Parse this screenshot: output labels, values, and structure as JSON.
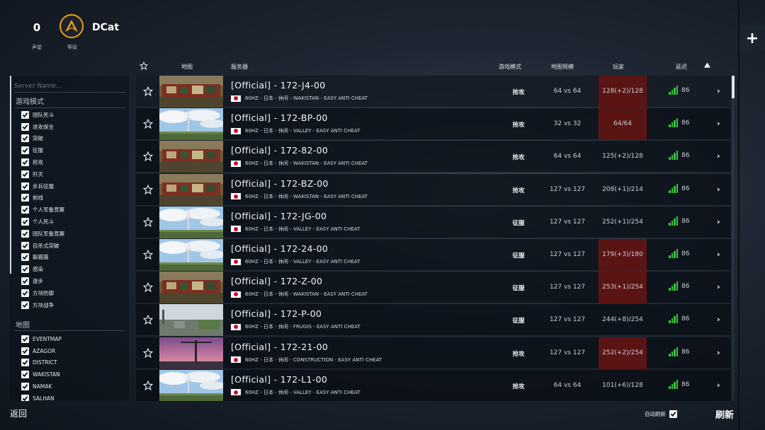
{
  "header": {
    "reputation": {
      "value": "0",
      "label": "声望"
    },
    "rank": {
      "label": "等级"
    },
    "username": "DCat"
  },
  "sidebar": {
    "search": {
      "placeholder": "Server Name..."
    },
    "mode_section_title": "游戏模式",
    "modes": [
      {
        "label": "团队死斗",
        "checked": true
      },
      {
        "label": "进攻保全",
        "checked": true
      },
      {
        "label": "突破",
        "checked": true
      },
      {
        "label": "征服",
        "checked": true
      },
      {
        "label": "抢攻",
        "checked": true
      },
      {
        "label": "歼灭",
        "checked": true
      },
      {
        "label": "步兵征服",
        "checked": true
      },
      {
        "label": "前线",
        "checked": true
      },
      {
        "label": "个人军备竞赛",
        "checked": true
      },
      {
        "label": "个人死斗",
        "checked": true
      },
      {
        "label": "团队军备竞赛",
        "checked": true
      },
      {
        "label": "自杀式突破",
        "checked": true
      },
      {
        "label": "躲猫猫",
        "checked": true
      },
      {
        "label": "感染",
        "checked": true
      },
      {
        "label": "逐步",
        "checked": true
      },
      {
        "label": "方块防御",
        "checked": true
      },
      {
        "label": "方块战争",
        "checked": true
      }
    ],
    "map_section_title": "地图",
    "maps": [
      {
        "label": "EVENTMAP",
        "checked": true
      },
      {
        "label": "AZAGOR",
        "checked": true
      },
      {
        "label": "DISTRICT",
        "checked": true
      },
      {
        "label": "WAKISTAN",
        "checked": true
      },
      {
        "label": "NAMAK",
        "checked": true
      },
      {
        "label": "SALHAN",
        "checked": true
      }
    ]
  },
  "table": {
    "headers": {
      "map": "地图",
      "server": "服务器",
      "mode": "游戏模式",
      "size": "地图规模",
      "players": "玩家",
      "ping": "延迟"
    },
    "rows": [
      {
        "name": "[Official] - 172-J4-00",
        "hz": "60HZ",
        "region": "日本",
        "type": "休闲",
        "map": "WAKISTAN",
        "anticheat": "EASY ANTI CHEAT",
        "mode": "抢攻",
        "size": "64 vs 64",
        "players": "128(+2)/128",
        "full": true,
        "ping": "86",
        "thumb": "wakistan"
      },
      {
        "name": "[Official] - 172-BP-00",
        "hz": "60HZ",
        "region": "日本",
        "type": "休闲",
        "map": "VALLEY",
        "anticheat": "EASY ANTI CHEAT",
        "mode": "抢攻",
        "size": "32 vs 32",
        "players": "64/64",
        "full": true,
        "ping": "86",
        "thumb": "valley"
      },
      {
        "name": "[Official] - 172-82-00",
        "hz": "60HZ",
        "region": "日本",
        "type": "休闲",
        "map": "WAKISTAN",
        "anticheat": "EASY ANTI CHEAT",
        "mode": "抢攻",
        "size": "64 vs 64",
        "players": "125(+2)/128",
        "full": false,
        "ping": "86",
        "thumb": "wakistan"
      },
      {
        "name": "[Official] - 172-BZ-00",
        "hz": "60HZ",
        "region": "日本",
        "type": "休闲",
        "map": "WAKISTAN",
        "anticheat": "EASY ANTI CHEAT",
        "mode": "抢攻",
        "size": "127 vs 127",
        "players": "208(+1)/214",
        "full": false,
        "ping": "86",
        "thumb": "wakistan"
      },
      {
        "name": "[Official] - 172-JG-00",
        "hz": "60HZ",
        "region": "日本",
        "type": "休闲",
        "map": "VALLEY",
        "anticheat": "EASY ANTI CHEAT",
        "mode": "征服",
        "size": "127 vs 127",
        "players": "252(+1)/254",
        "full": false,
        "ping": "86",
        "thumb": "valley"
      },
      {
        "name": "[Official] - 172-24-00",
        "hz": "60HZ",
        "region": "日本",
        "type": "休闲",
        "map": "VALLEY",
        "anticheat": "EASY ANTI CHEAT",
        "mode": "征服",
        "size": "127 vs 127",
        "players": "179(+3)/180",
        "full": true,
        "ping": "86",
        "thumb": "valley"
      },
      {
        "name": "[Official] - 172-Z-00",
        "hz": "60HZ",
        "region": "日本",
        "type": "休闲",
        "map": "WAKISTAN",
        "anticheat": "EASY ANTI CHEAT",
        "mode": "征服",
        "size": "127 vs 127",
        "players": "253(+1)/254",
        "full": true,
        "ping": "86",
        "thumb": "wakistan"
      },
      {
        "name": "[Official] - 172-P-00",
        "hz": "60HZ",
        "region": "日本",
        "type": "休闲",
        "map": "FRUGIS",
        "anticheat": "EASY ANTI CHEAT",
        "mode": "征服",
        "size": "127 vs 127",
        "players": "244(+8)/254",
        "full": false,
        "ping": "86",
        "thumb": "frugis"
      },
      {
        "name": "[Official] - 172-21-00",
        "hz": "60HZ",
        "region": "日本",
        "type": "休闲",
        "map": "CONSTRUCTION",
        "anticheat": "EASY ANTI CHEAT",
        "mode": "抢攻",
        "size": "127 vs 127",
        "players": "252(+2)/254",
        "full": true,
        "ping": "86",
        "thumb": "construction"
      },
      {
        "name": "[Official] - 172-L1-00",
        "hz": "60HZ",
        "region": "日本",
        "type": "休闲",
        "map": "VALLEY",
        "anticheat": "EASY ANTI CHEAT",
        "mode": "抢攻",
        "size": "64 vs 64",
        "players": "101(+6)/128",
        "full": false,
        "ping": "86",
        "thumb": "valley"
      }
    ]
  },
  "footer": {
    "back_label": "返回",
    "auto_refresh_label": "自动刷新",
    "auto_refresh_checked": true,
    "refresh_label": "刷新"
  },
  "colors": {
    "accent_gold": "#e8a21c",
    "full_server_red": "#5a1414",
    "ping_green": "#35c23b"
  },
  "icons": {
    "rank": "rank-emblem-icon",
    "favorite": "star-outline-icon",
    "sort": "triangle-up-icon",
    "add": "plus-icon",
    "row_open": "chevron-right-icon",
    "checkbox": "checkmark-icon",
    "ping": "signal-bars-icon"
  }
}
